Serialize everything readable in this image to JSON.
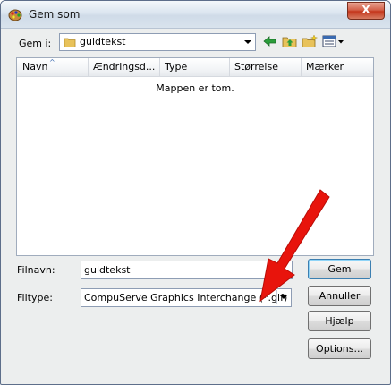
{
  "window": {
    "title": "Gem som",
    "close_glyph": "X"
  },
  "location": {
    "label": "Gem i:",
    "value": "guldtekst"
  },
  "toolbar": {
    "icons": [
      "back-icon",
      "up-folder-icon",
      "new-folder-icon",
      "view-menu-icon"
    ]
  },
  "list": {
    "columns": [
      "Navn",
      "Ændringsd...",
      "Type",
      "Størrelse",
      "Mærker"
    ],
    "empty_message": "Mappen er tom."
  },
  "filename": {
    "label": "Filnavn:",
    "value": "guldtekst"
  },
  "filetype": {
    "label": "Filtype:",
    "value": "CompuServe Graphics Interchange (*.gif)"
  },
  "buttons": {
    "save": "Gem",
    "cancel": "Annuller",
    "help": "Hjælp",
    "options": "Options..."
  },
  "colors": {
    "accent_arrow": "#e8140c",
    "title_gradient_mid": "#dbe5ef"
  }
}
